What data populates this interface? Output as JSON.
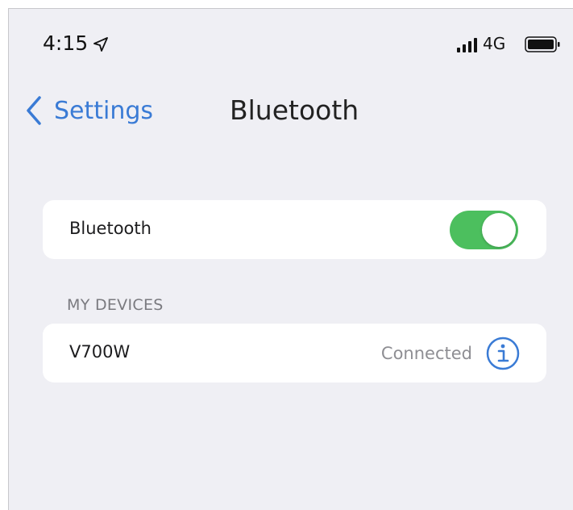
{
  "status_bar": {
    "time": "4:15",
    "network": "4G",
    "icons": [
      "location-arrow-icon",
      "signal-bars-icon",
      "battery-icon"
    ]
  },
  "nav": {
    "back_label": "Settings",
    "title": "Bluetooth"
  },
  "bluetooth_row": {
    "label": "Bluetooth",
    "enabled": true
  },
  "my_devices": {
    "header": "MY DEVICES",
    "devices": [
      {
        "name": "V700W",
        "status": "Connected",
        "icon": "info-icon"
      }
    ]
  },
  "colors": {
    "accent": "#3a7bd5",
    "toggle_on": "#4cbf5e",
    "background": "#efeff4"
  }
}
